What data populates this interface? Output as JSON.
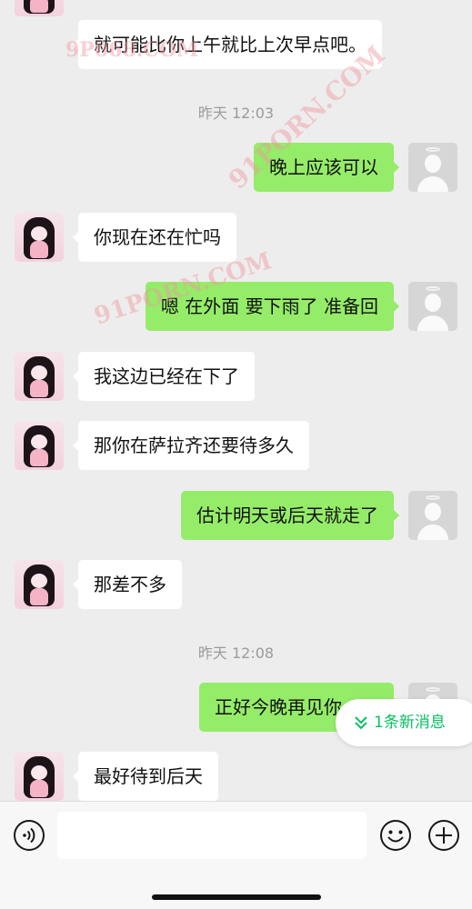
{
  "watermarks": [
    "9P068.COM",
    "91PORN.COM",
    "91PORN.COM"
  ],
  "messages": [
    {
      "side": "in",
      "text": "就可能比你上午就比上次早点吧。"
    },
    {
      "timestamp": "昨天 12:03"
    },
    {
      "side": "out",
      "text": "晚上应该可以"
    },
    {
      "side": "in",
      "text": "你现在还在忙吗"
    },
    {
      "side": "out",
      "text": "嗯 在外面 要下雨了 准备回"
    },
    {
      "side": "in",
      "text": "我这边已经在下了"
    },
    {
      "side": "in",
      "text": "那你在萨拉齐还要待多久"
    },
    {
      "side": "out",
      "text": "估计明天或后天就走了"
    },
    {
      "side": "in",
      "text": "那差不多"
    },
    {
      "timestamp": "昨天 12:08"
    },
    {
      "side": "out",
      "text": "正好今晚再见你一面"
    },
    {
      "side": "in",
      "text": "最好待到后天"
    }
  ],
  "new_message_pill": {
    "label": "1条新消息",
    "icon": "double-chevron-down-icon",
    "color": "#07c160"
  },
  "input_bar": {
    "voice_icon": "voice-icon",
    "message_value": "",
    "emoji_icon": "emoji-icon",
    "plus_icon": "plus-icon"
  },
  "colors": {
    "outgoing_bubble": "#95ec69",
    "incoming_bubble": "#ffffff",
    "background": "#ededed"
  }
}
